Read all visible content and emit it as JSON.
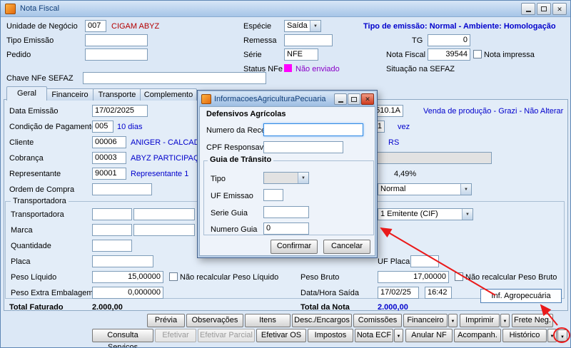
{
  "window": {
    "title": "Nota Fiscal"
  },
  "header": {
    "unidade": {
      "label": "Unidade de Negócio",
      "code": "007",
      "name": "CIGAM ABYZ"
    },
    "tipo_emissao_label": "Tipo Emissão",
    "pedido_label": "Pedido",
    "especie": {
      "label": "Espécie",
      "value": "Saída"
    },
    "remessa_label": "Remessa",
    "serie": {
      "label": "Série",
      "value": "NFE"
    },
    "status_nfe": {
      "label": "Status NFe",
      "value": "Não enviado"
    },
    "emissao_ambiente": "Tipo de emissão: Normal - Ambiente: Homologação",
    "tg": {
      "label": "TG",
      "value": "0"
    },
    "nota_fiscal": {
      "label": "Nota Fiscal",
      "value": "39544"
    },
    "nota_impressa_label": "Nota impressa",
    "situacao_sefaz_label": "Situação na SEFAZ",
    "chave_label": "Chave NFe SEFAZ"
  },
  "tabs": {
    "geral": "Geral",
    "financeiro": "Financeiro",
    "transporte": "Transporte",
    "complemento": "Complemento"
  },
  "geral": {
    "data_emissao": {
      "label": "Data Emissão",
      "value": "17/02/2025"
    },
    "natureza": {
      "code": "510.1A",
      "desc": "Venda de produção - Grazi - Não Alterar"
    },
    "cond_pag": {
      "label": "Condição de Pagamento",
      "code": "005",
      "desc": "10 dias",
      "parcela": "1",
      "parcela_suffix": "vez"
    },
    "cliente": {
      "label": "Cliente",
      "code": "00006",
      "desc": "ANIGER - CALCADOS",
      "uf": "RS"
    },
    "cobranca": {
      "label": "Cobrança",
      "code": "00003",
      "desc": "ABYZ PARTICIPAÇÕ"
    },
    "representante": {
      "label": "Representante",
      "code": "90001",
      "desc": "Representante 1",
      "comissao": "4,49%"
    },
    "ordem_compra_label": "Ordem de Compra",
    "tipo_value": "Normal",
    "transp": {
      "title": "Transportadora",
      "transportadora_label": "Transportadora",
      "frete_combo": "1 Emitente (CIF)",
      "marca_label": "Marca",
      "quantidade_label": "Quantidade",
      "placa_label": "Placa",
      "uf_placa_label": "UF Placa",
      "peso_liquido": {
        "label": "Peso Líquido",
        "value": "15,00000",
        "checkbox_label": "Não recalcular Peso Líquido"
      },
      "peso_bruto": {
        "label": "Peso Bruto",
        "value": "17,00000",
        "checkbox_label": "Não recalcular Peso Bruto"
      },
      "peso_extra": {
        "label": "Peso Extra Embalagem",
        "value": "0,000000"
      },
      "saida": {
        "label": "Data/Hora Saída",
        "date": "17/02/25",
        "time": "16:42"
      }
    },
    "total_faturado": {
      "label": "Total Faturado",
      "value": "2.000,00"
    },
    "total_nota": {
      "label": "Total da Nota",
      "value": "2.000,00"
    }
  },
  "agro_menu": {
    "label": "Inf. Agropecuária"
  },
  "modal": {
    "title": "InformacoesAgriculturaPecuaria",
    "defensivos_title": "Defensivos Agrícolas",
    "numero_receita_label": "Numero da Receita",
    "cpf_label": "CPF Responsavel",
    "guia_title": "Guia de Trânsito",
    "tipo_label": "Tipo",
    "uf_emissao_label": "UF Emissao",
    "serie_guia_label": "Serie Guia",
    "numero_guia": {
      "label": "Numero Guia",
      "value": "0"
    },
    "confirm_label": "Confirmar",
    "cancel_label": "Cancelar"
  },
  "footer": {
    "row1": [
      {
        "label": "Prévia"
      },
      {
        "label": "Observações"
      },
      {
        "label": "Itens"
      },
      {
        "label": "Desc./Encargos"
      },
      {
        "label": "Comissões"
      },
      {
        "label": "Financeiro",
        "arrow": true
      },
      {
        "label": "Imprimir",
        "arrow": true
      },
      {
        "label": "Frete Neg."
      }
    ],
    "row2": [
      {
        "label": "Consulta Serviços"
      },
      {
        "label": "Efetivar",
        "disabled": true
      },
      {
        "label": "Efetivar Parcial",
        "disabled": true
      },
      {
        "label": "Efetivar OS"
      },
      {
        "label": "Impostos"
      },
      {
        "label": "Nota ECF",
        "arrow": true
      },
      {
        "label": "Anular NF"
      },
      {
        "label": "Acompanh."
      },
      {
        "label": "Histórico",
        "arrow": true
      }
    ]
  },
  "colors": {
    "status_nfe_icon": "#ff00ff",
    "status_nfe_text": "#8a00c8",
    "link_blue": "#0000cc",
    "unit_name_red": "#b40000",
    "total_nota_blue": "#0000cc",
    "annotation_red": "#ea1a1a"
  }
}
